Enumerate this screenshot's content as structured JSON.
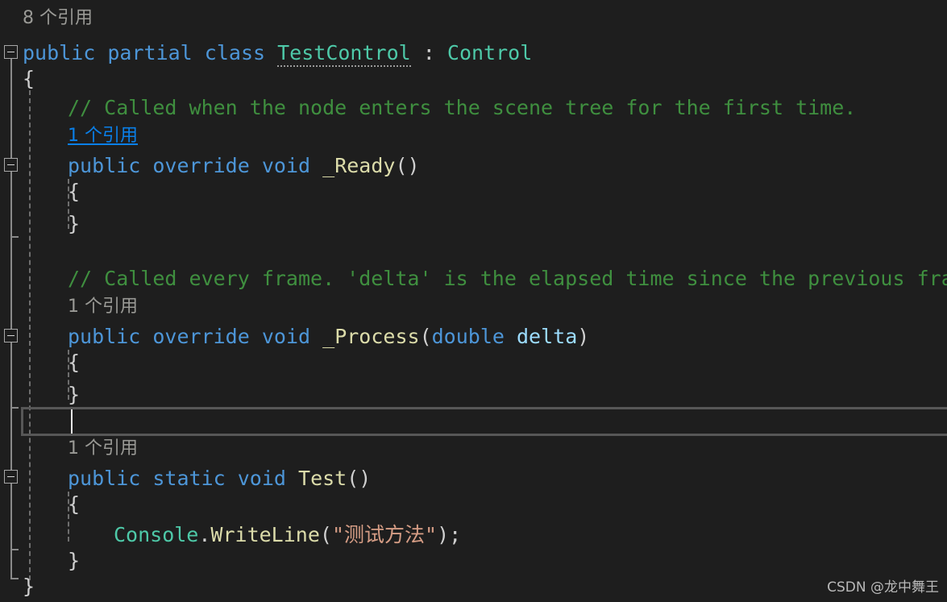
{
  "editor": {
    "background_color": "#1e1e1e",
    "language": "csharp",
    "colors": {
      "keyword": "#4d96d8",
      "type": "#4ec9a8",
      "method": "#dcdcaa",
      "parameter": "#9cdcfe",
      "comment": "#3f8f3f",
      "string": "#d69d85",
      "punctuation": "#cfcfcf",
      "codelens_inactive": "#9a9a96",
      "codelens_active": "#0a7fe8",
      "current_line_border": "#575757",
      "fold_margin": "#8a8a8a",
      "indent_guide": "#6e6e6e"
    }
  },
  "codelens": [
    {
      "id": "class-refs",
      "text": "8 个引用",
      "state": "inactive"
    },
    {
      "id": "ready-refs",
      "text": "1 个引用",
      "state": "active"
    },
    {
      "id": "process-refs",
      "text": "1 个引用",
      "state": "inactive"
    },
    {
      "id": "test-refs",
      "text": "1 个引用",
      "state": "inactive"
    }
  ],
  "code": {
    "class_declaration": {
      "keyword_public": "public",
      "keyword_partial": "partial",
      "keyword_class": "class",
      "class_name": "TestControl",
      "colon": ":",
      "base_type": "Control"
    },
    "comments": {
      "ready": "// Called when the node enters the scene tree for the first time.",
      "process": "// Called every frame. 'delta' is the elapsed time since the previous frame."
    },
    "ready_method": {
      "keyword_public": "public",
      "keyword_override": "override",
      "keyword_void": "void",
      "name": "_Ready",
      "parens": "()"
    },
    "process_method": {
      "keyword_public": "public",
      "keyword_override": "override",
      "keyword_void": "void",
      "name": "_Process",
      "open_paren": "(",
      "param_type": "double",
      "param_name": "delta",
      "close_paren": ")"
    },
    "test_method": {
      "keyword_public": "public",
      "keyword_static": "static",
      "keyword_void": "void",
      "name": "Test",
      "parens": "()"
    },
    "console_call": {
      "class_name": "Console",
      "dot": ".",
      "method": "WriteLine",
      "open_paren": "(",
      "string_literal": "\"测试方法\"",
      "close_paren_semi": ");"
    },
    "braces": {
      "open": "{",
      "close": "}"
    }
  },
  "watermark": {
    "text": "CSDN @龙中舞王"
  }
}
